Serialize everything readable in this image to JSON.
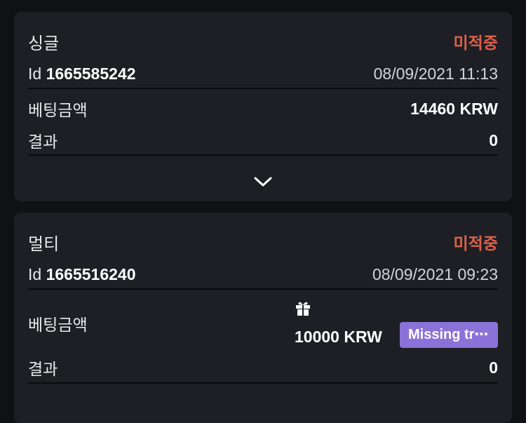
{
  "bets": [
    {
      "type": "싱글",
      "status": "미적중",
      "id_label": "Id",
      "id": "1665585242",
      "datetime": "08/09/2021 11:13",
      "bet_label": "베팅금액",
      "bet_amount": "14460 KRW",
      "result_label": "결과",
      "result": "0",
      "expand_icon": "chevron-down-icon"
    },
    {
      "type": "멀티",
      "status": "미적중",
      "id_label": "Id",
      "id": "1665516240",
      "datetime": "08/09/2021 09:23",
      "bet_label": "베팅금액",
      "bet_icon": "gift-icon",
      "bet_amount": "10000 KRW",
      "badge": "Missing tr⋯",
      "result_label": "결과",
      "result": "0"
    }
  ],
  "colors": {
    "status": "#e0604a",
    "badge": "#8a72d8",
    "card": "#1d1f24",
    "background": "#101114"
  }
}
